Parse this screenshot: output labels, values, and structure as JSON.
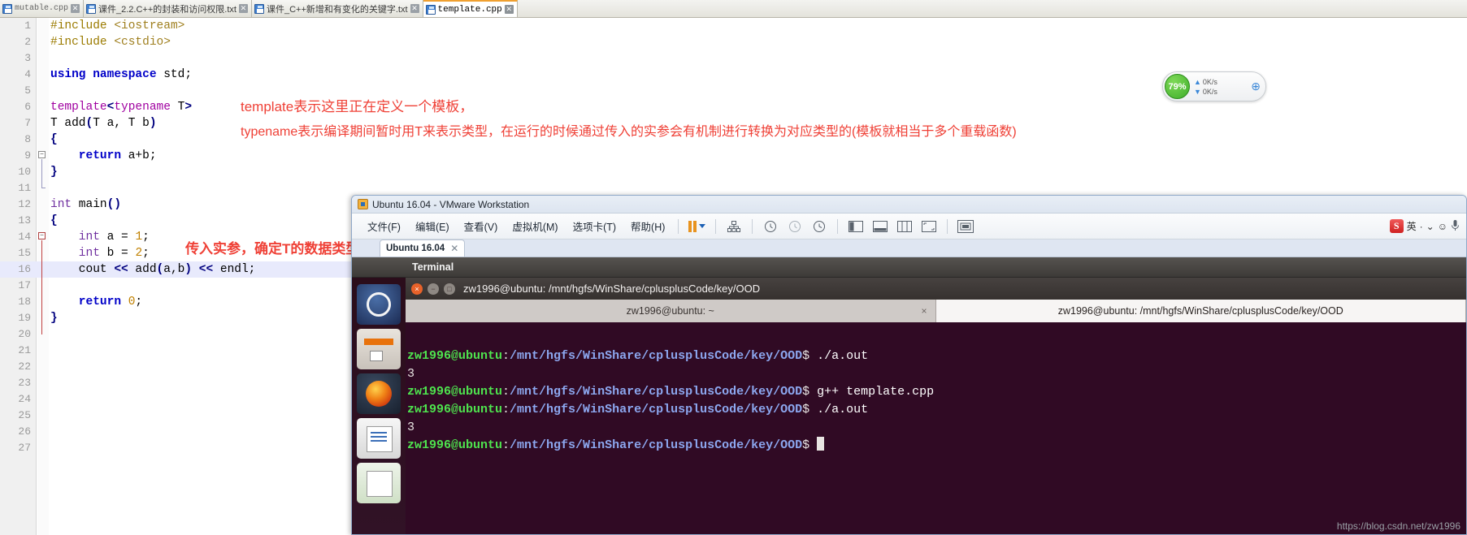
{
  "editor": {
    "tabs": [
      {
        "label": "mutable.cpp",
        "active": false,
        "mono": true
      },
      {
        "label": "课件_2.2.C++的封装和访问权限.txt",
        "active": false,
        "mono": false
      },
      {
        "label": "课件_C++新增和有变化的关键字.txt",
        "active": false,
        "mono": false
      },
      {
        "label": "template.cpp",
        "active": true,
        "mono": true
      }
    ],
    "close_glyph": "✕",
    "code_lines": [
      {
        "n": "1",
        "tokens": [
          {
            "t": "#include ",
            "c": "k-pre"
          },
          {
            "t": "<iostream>",
            "c": "k-str"
          }
        ]
      },
      {
        "n": "2",
        "tokens": [
          {
            "t": "#include ",
            "c": "k-pre"
          },
          {
            "t": "<cstdio>",
            "c": "k-str"
          }
        ]
      },
      {
        "n": "3",
        "tokens": []
      },
      {
        "n": "4",
        "tokens": [
          {
            "t": "using namespace ",
            "c": "k-blue"
          },
          {
            "t": "std;",
            "c": "k-plain"
          }
        ]
      },
      {
        "n": "5",
        "tokens": []
      },
      {
        "n": "6",
        "tokens": [
          {
            "t": "template",
            "c": "k-purp"
          },
          {
            "t": "<",
            "c": "k-darkblue"
          },
          {
            "t": "typename",
            "c": "k-purp"
          },
          {
            "t": " T",
            "c": "k-plain"
          },
          {
            "t": ">",
            "c": "k-darkblue"
          }
        ]
      },
      {
        "n": "7",
        "tokens": [
          {
            "t": "T add",
            "c": "k-plain"
          },
          {
            "t": "(",
            "c": "k-darkblue"
          },
          {
            "t": "T a, T b",
            "c": "k-plain"
          },
          {
            "t": ")",
            "c": "k-darkblue"
          }
        ]
      },
      {
        "n": "8",
        "tokens": [
          {
            "t": "{",
            "c": "k-darkblue"
          }
        ]
      },
      {
        "n": "9",
        "tokens": [
          {
            "t": "    return ",
            "c": "k-blue"
          },
          {
            "t": "a+b;",
            "c": "k-plain"
          }
        ]
      },
      {
        "n": "10",
        "tokens": [
          {
            "t": "}",
            "c": "k-darkblue"
          }
        ]
      },
      {
        "n": "11",
        "tokens": []
      },
      {
        "n": "12",
        "tokens": [
          {
            "t": "int",
            "c": "k-type"
          },
          {
            "t": " main",
            "c": "k-plain"
          },
          {
            "t": "()",
            "c": "k-darkblue"
          }
        ]
      },
      {
        "n": "13",
        "tokens": [
          {
            "t": "{",
            "c": "k-darkblue"
          }
        ]
      },
      {
        "n": "14",
        "tokens": [
          {
            "t": "    int",
            "c": "k-type"
          },
          {
            "t": " a = ",
            "c": "k-plain"
          },
          {
            "t": "1",
            "c": "k-num"
          },
          {
            "t": ";",
            "c": "k-plain"
          }
        ]
      },
      {
        "n": "15",
        "tokens": [
          {
            "t": "    int",
            "c": "k-type"
          },
          {
            "t": " b = ",
            "c": "k-plain"
          },
          {
            "t": "2",
            "c": "k-num"
          },
          {
            "t": ";",
            "c": "k-plain"
          }
        ]
      },
      {
        "n": "16",
        "tokens": [
          {
            "t": "    cout ",
            "c": "k-plain"
          },
          {
            "t": "<<",
            "c": "k-darkblue"
          },
          {
            "t": " add",
            "c": "k-plain"
          },
          {
            "t": "(",
            "c": "k-darkblue"
          },
          {
            "t": "a,b",
            "c": "k-plain"
          },
          {
            "t": ")",
            "c": "k-darkblue"
          },
          {
            "t": " ",
            "c": "k-plain"
          },
          {
            "t": "<<",
            "c": "k-darkblue"
          },
          {
            "t": " endl;",
            "c": "k-plain"
          }
        ],
        "highlight": true
      },
      {
        "n": "17",
        "tokens": []
      },
      {
        "n": "18",
        "tokens": [
          {
            "t": "    return ",
            "c": "k-blue"
          },
          {
            "t": "0",
            "c": "k-num"
          },
          {
            "t": ";",
            "c": "k-plain"
          }
        ]
      },
      {
        "n": "19",
        "tokens": [
          {
            "t": "}",
            "c": "k-darkblue"
          }
        ]
      },
      {
        "n": "20",
        "tokens": []
      },
      {
        "n": "21",
        "tokens": []
      },
      {
        "n": "22",
        "tokens": []
      },
      {
        "n": "23",
        "tokens": []
      },
      {
        "n": "24",
        "tokens": []
      },
      {
        "n": "25",
        "tokens": []
      },
      {
        "n": "26",
        "tokens": []
      },
      {
        "n": "27",
        "tokens": []
      }
    ],
    "annotations": {
      "line1": "template表示这里正在定义一个模板，",
      "line2": "typename表示编译期间暂时用T来表示类型，在运行的时候通过传入的实参会有机制进行转换为对应类型的(模板就相当于多个重载函数)",
      "line3": "传入实参，确定T的数据类型"
    }
  },
  "speed_widget": {
    "percent": "79%",
    "up_rate": "0K/s",
    "down_rate": "0K/s",
    "up_arrow": "▲",
    "down_arrow": "▼",
    "expand_glyph": "⊕"
  },
  "vmware": {
    "title": "Ubuntu 16.04 - VMware Workstation",
    "menu": [
      {
        "label": "文件(F)"
      },
      {
        "label": "编辑(E)"
      },
      {
        "label": "查看(V)"
      },
      {
        "label": "虚拟机(M)"
      },
      {
        "label": "选项卡(T)"
      },
      {
        "label": "帮助(H)"
      }
    ],
    "tab": {
      "label": "Ubuntu 16.04",
      "close_glyph": "✕"
    },
    "ime": {
      "letter": "S",
      "mode": "英",
      "dot": "·",
      "sep": "⌄",
      "smiley": "☺",
      "mic": "🎤"
    }
  },
  "guest": {
    "topbar_title": "Terminal",
    "launcher_items": [
      {
        "name": "ubuntu-dash"
      },
      {
        "name": "files"
      },
      {
        "name": "firefox"
      },
      {
        "name": "libreoffice-writer"
      },
      {
        "name": "libreoffice-calc"
      }
    ],
    "terminal": {
      "window_title": "zw1996@ubuntu: /mnt/hgfs/WinShare/cplusplusCode/key/OOD",
      "tabs": [
        {
          "label": "zw1996@ubuntu: ~",
          "active": false,
          "close_glyph": "×"
        },
        {
          "label": "zw1996@ubuntu: /mnt/hgfs/WinShare/cplusplusCode/key/OOD",
          "active": true,
          "close_glyph": ""
        }
      ],
      "user": "zw1996@ubuntu",
      "path": "/mnt/hgfs/WinShare/cplusplusCode/key/OOD",
      "prompt_symbol": "$",
      "lines": [
        {
          "type": "prompt",
          "cmd": " ./a.out"
        },
        {
          "type": "output",
          "text": "3"
        },
        {
          "type": "prompt",
          "cmd": " g++ template.cpp"
        },
        {
          "type": "prompt",
          "cmd": " ./a.out"
        },
        {
          "type": "output",
          "text": "3"
        },
        {
          "type": "prompt",
          "cmd": " ",
          "cursor": true
        }
      ]
    }
  },
  "watermark": "https://blog.csdn.net/zw1996"
}
